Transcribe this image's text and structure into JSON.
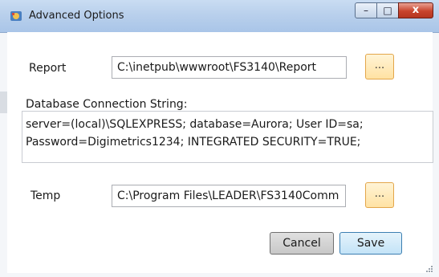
{
  "window": {
    "title": "Advanced Options",
    "controls": {
      "minimize": "–",
      "maximize": "□",
      "close": "x"
    }
  },
  "form": {
    "report": {
      "label": "Report",
      "value": "C:\\inetpub\\wwwroot\\FS3140\\Report",
      "browse_label": "..."
    },
    "connection": {
      "label": "Database Connection String:",
      "lines": [
        "server=(local)\\SQLEXPRESS; database=Aurora; User ID=sa;",
        "Password=Digimetrics1234; INTEGRATED SECURITY=TRUE;"
      ]
    },
    "temp": {
      "label": "Temp",
      "value": "C:\\Program Files\\LEADER\\FS3140Comm",
      "browse_label": "..."
    }
  },
  "buttons": {
    "cancel": "Cancel",
    "save": "Save"
  },
  "colors": {
    "titlebar": "#b9d0ec",
    "browse_accent": "#ffe2a3",
    "save_accent": "#c3e3f7",
    "close_red": "#c8432c"
  }
}
